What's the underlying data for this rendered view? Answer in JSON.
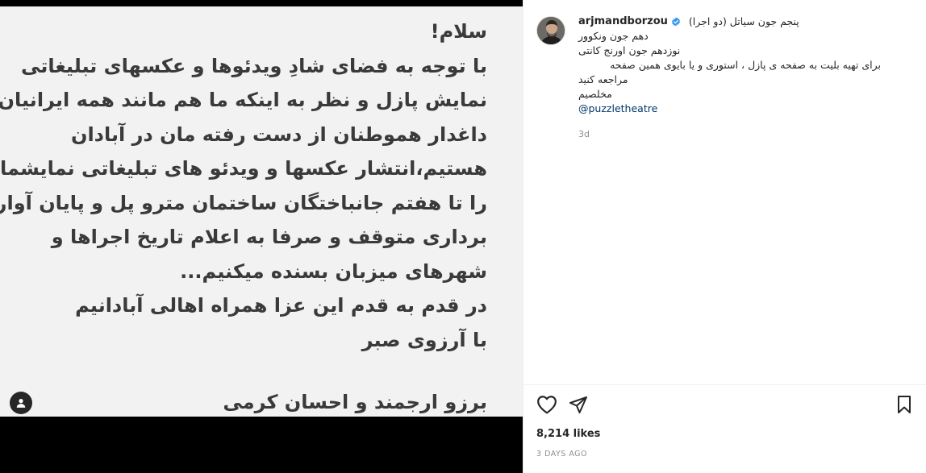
{
  "post_image": {
    "lines": [
      "سلام!",
      "با توجه به فضای شادِ ویدئوها و عکسهای تبلیغاتی",
      "نمایش پازل و نظر به اینکه ما هم مانند همه ایرانیان",
      "داغدار هموطنان از دست رفته مان در آبادان",
      "هستیم،انتشار عکسها و ویدئو های تبلیغاتی نمایشمان",
      "را تا هفتم جانباختگان ساختمان مترو پل و پایان آوار",
      "برداری متوقف و صرفا به اعلام تاریخ اجراها و",
      "شهرهای میزبان بسنده میکنیم...",
      "در قدم به قدم این عزا همراه اهالی آبادانیم",
      "با آرزوی صبر"
    ],
    "signature": "برزو ارجمند و احسان کرمی"
  },
  "caption": {
    "username": "arjmandborzou",
    "first_line": "پنجم جون سیاتل (دو اجرا)",
    "lines": [
      "دهم جون ونکوور",
      "نوزدهم جون اورنج کانتی",
      "برای تهیه بلیت به صفحه ی پازل ، استوری و یا بایوی همین صفحه",
      "مراجعه کنید",
      "مخلصیم"
    ],
    "mention": "@puzzletheatre",
    "time_ago": "3d"
  },
  "stats": {
    "likes": "8,214 likes",
    "date": "3 DAYS AGO"
  },
  "icons": {
    "verified": "verified-badge-icon",
    "like": "heart-icon",
    "share": "send-icon",
    "save": "bookmark-icon",
    "tag": "user-tag-icon"
  },
  "colors": {
    "verified": "#3897f0",
    "mention": "#00376b",
    "muted": "#8e8e8e"
  }
}
